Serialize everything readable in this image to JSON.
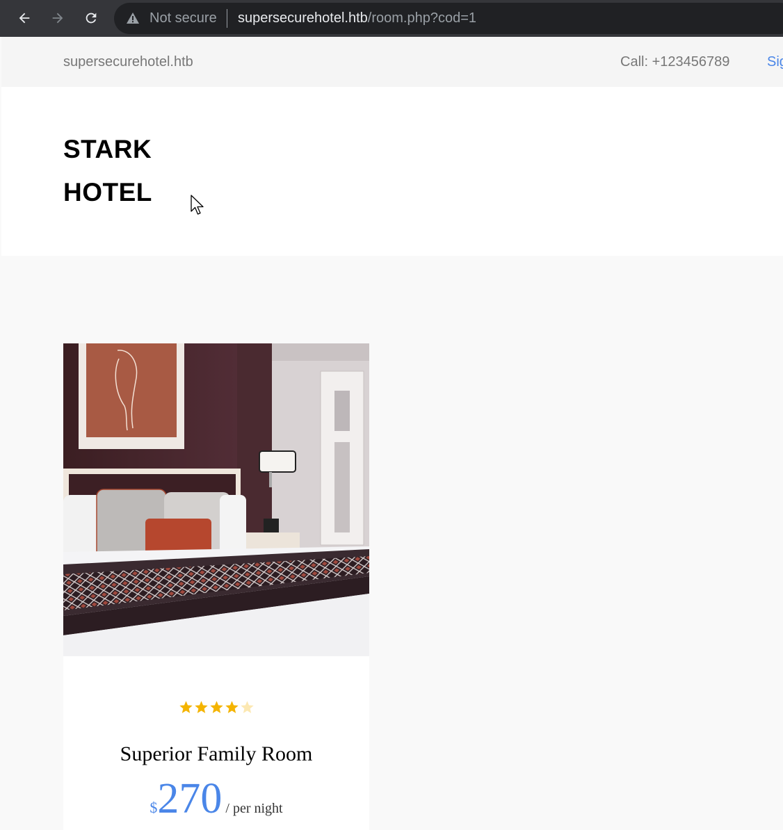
{
  "browser": {
    "security_label": "Not secure",
    "url_host": "supersecurehotel.htb",
    "url_path": "/room.php?cod=1"
  },
  "topbar": {
    "domain": "supersecurehotel.htb",
    "call": "Call: +123456789",
    "signin": "Sig"
  },
  "brand": {
    "line1": "STARK",
    "line2": "HOTEL"
  },
  "room": {
    "rating": 4,
    "rating_max": 5,
    "title": "Superior Family Room",
    "currency": "$",
    "price": "270",
    "unit": " / per night"
  },
  "colors": {
    "accent": "#4a86e8",
    "star": "#f4b400"
  }
}
